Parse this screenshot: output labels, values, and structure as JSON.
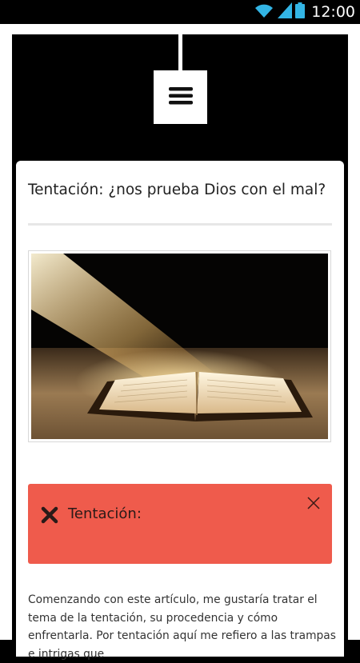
{
  "status_bar": {
    "time": "12:00",
    "icons": [
      "wifi-icon",
      "signal-icon",
      "battery-icon"
    ],
    "accent_color": "#33b5e5"
  },
  "header": {
    "menu_icon": "hamburger-menu-icon"
  },
  "article": {
    "title": "Tentación: ¿nos prueba Dios con el mal?",
    "image": {
      "subject": "open-book-with-light-beam"
    },
    "alert": {
      "label": "Tentación:",
      "icon": "x-mark-icon",
      "close_icon": "close-icon",
      "color": "#ef5b4c"
    },
    "body": "Comenzando con este artículo, me gustaría tratar el tema de la tentación, su procedencia y cómo enfrentarla. Por tentación aquí me refiero a las trampas e intrigas que"
  }
}
